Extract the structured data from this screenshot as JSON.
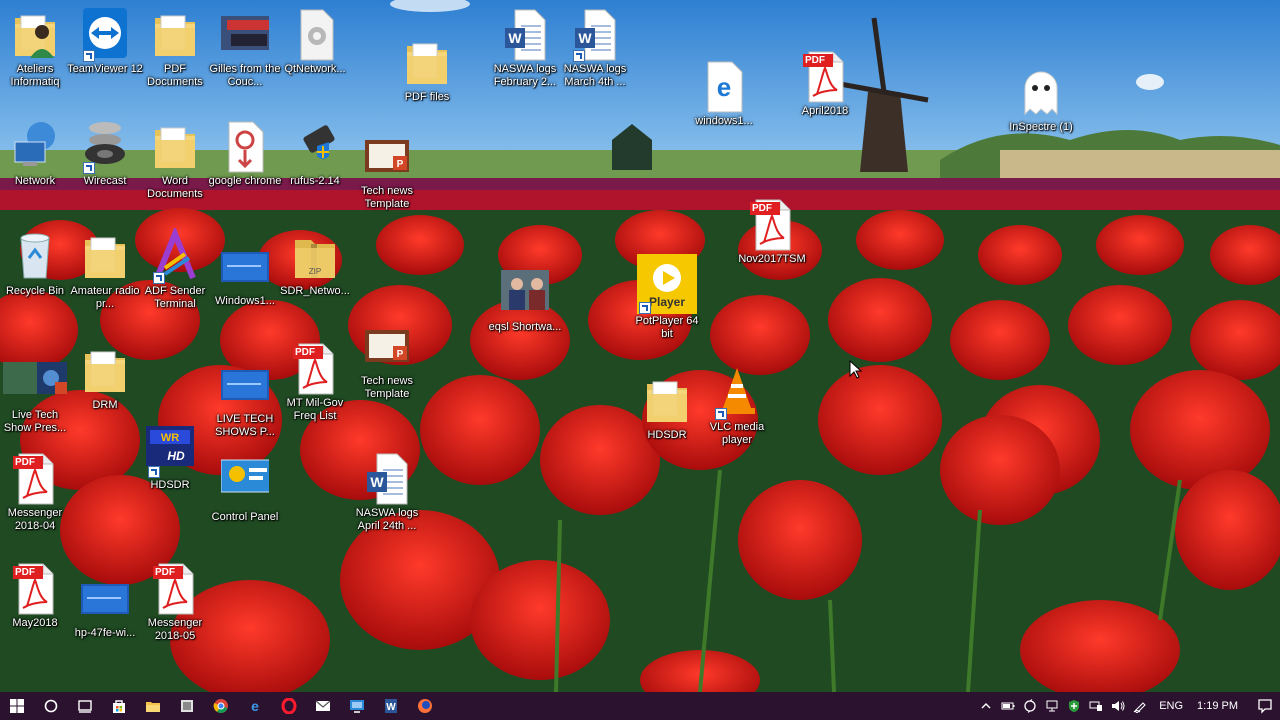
{
  "desktop": {
    "icons": [
      {
        "label": "Ateliers Informatiq"
      },
      {
        "label": "TeamViewer 12"
      },
      {
        "label": "PDF Documents"
      },
      {
        "label": "Gilles from the Couc..."
      },
      {
        "label": "QtNetwork..."
      },
      {
        "label": "PDF files"
      },
      {
        "label": "NASWA logs February 2..."
      },
      {
        "label": "NASWA logs March 4th ..."
      },
      {
        "label": "windows1..."
      },
      {
        "label": "April2018"
      },
      {
        "label": "InSpectre (1)"
      },
      {
        "label": "Network"
      },
      {
        "label": "Wirecast"
      },
      {
        "label": "Word Documents"
      },
      {
        "label": "google chrome"
      },
      {
        "label": "rufus-2.14"
      },
      {
        "label": "Tech news Template"
      },
      {
        "label": "Nov2017TSM"
      },
      {
        "label": "Recycle Bin"
      },
      {
        "label": "Amateur radio pr..."
      },
      {
        "label": "ADF Sender Terminal"
      },
      {
        "label": "Windows1..."
      },
      {
        "label": "SDR_Netwo..."
      },
      {
        "label": "eqsl Shortwa..."
      },
      {
        "label": "PotPlayer 64 bit"
      },
      {
        "label": "Live Tech Show Pres..."
      },
      {
        "label": "DRM"
      },
      {
        "label": "LIVE TECH SHOWS P..."
      },
      {
        "label": "MT Mil-Gov Freq List"
      },
      {
        "label": "Tech news Template"
      },
      {
        "label": "HDSDR"
      },
      {
        "label": "VLC media player"
      },
      {
        "label": "HDSDR"
      },
      {
        "label": "Messenger 2018-04"
      },
      {
        "label": "Control Panel"
      },
      {
        "label": "NASWA logs April 24th ..."
      },
      {
        "label": "May2018"
      },
      {
        "label": "hp-47fe-wi..."
      },
      {
        "label": "Messenger 2018-05"
      }
    ],
    "pdf_badge": "PDF",
    "player_badge": "Player",
    "hdsdr_badge": "WR HD"
  },
  "taskbar": {
    "items": [
      "start-icon",
      "cortana-icon",
      "task-view-icon",
      "store-icon",
      "file-explorer-icon",
      "folder-icon",
      "chrome-icon",
      "edge-icon",
      "opera-icon",
      "mail-icon",
      "remote-icon",
      "word-icon",
      "firefox-icon"
    ],
    "language": "ENG",
    "time": "1:19 PM"
  },
  "colors": {
    "taskbar": "#2b1330",
    "tulip": "#d81818",
    "sky": "#3f8fd8"
  }
}
